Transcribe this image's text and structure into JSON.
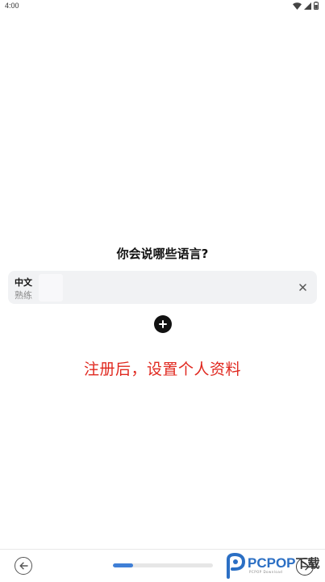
{
  "status_bar": {
    "time": "4:00",
    "icons": [
      "wifi-icon",
      "signal-icon",
      "battery-icon"
    ]
  },
  "question": "你会说哪些语言?",
  "languages": [
    {
      "name": "中文",
      "level": "熟练",
      "remove_icon": "close-icon"
    }
  ],
  "add_button": {
    "icon": "plus-icon"
  },
  "annotation": "注册后，设置个人资料",
  "bottom_bar": {
    "back_icon": "arrow-left-icon",
    "next_icon": "arrow-right-icon",
    "progress": 0.2,
    "progress_color": "#3f7fd6"
  },
  "watermark": {
    "brand": "PCPOP",
    "suffix": "下载",
    "sub": "PCPOP Download"
  },
  "colors": {
    "annotation": "#e0281f",
    "card_bg": "#f1f2f4",
    "watermark_blue": "#2b6fc4"
  }
}
